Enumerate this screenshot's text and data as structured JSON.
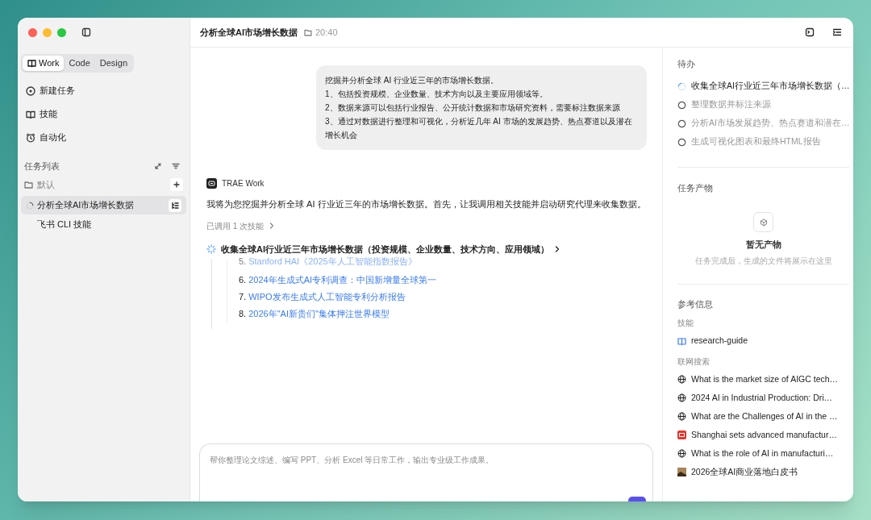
{
  "sidebar": {
    "modes": [
      {
        "label": "Work",
        "selected": true
      },
      {
        "label": "Code",
        "selected": false
      },
      {
        "label": "Design",
        "selected": false
      }
    ],
    "nav": [
      {
        "label": "新建任务",
        "kind": "chat"
      },
      {
        "label": "技能",
        "kind": "book"
      },
      {
        "label": "自动化",
        "kind": "alarm"
      }
    ],
    "task_list_title": "任务列表",
    "group": "默认",
    "tasks": [
      {
        "title": "分析全球AI市场增长数据",
        "selected": true,
        "running": true
      },
      {
        "title": "飞书 CLI 技能",
        "selected": false,
        "running": false
      }
    ]
  },
  "header": {
    "title": "分析全球AI市场增长数据",
    "time": "20:40"
  },
  "user_message": [
    "挖掘并分析全球 AI 行业近三年的市场增长数据。",
    "1、包括投资规模、企业数量、技术方向以及主要应用领域等。",
    "2、数据来源可以包括行业报告、公开统计数据和市场研究资料，需要标注数据来源",
    "3、通过对数据进行整理和可视化，分析近几年 AI 市场的发展趋势、热点赛道以及潜在增长机会"
  ],
  "assistant": {
    "name": "TRAE Work",
    "text": "我将为您挖掘并分析全球 AI 行业近三年的市场增长数据。首先，让我调用相关技能并启动研究代理来收集数据。",
    "skill_calls": "已调用 1 次技能",
    "step": {
      "title": "收集全球AI行业近三年市场增长数据（投资规模、企业数量、技术方向、应用领域）",
      "running": true,
      "results": [
        {
          "number": "5.",
          "title": "Stanford HAI《2025年人工智能指数报告》",
          "faded": true
        },
        {
          "number": "6.",
          "title": "2024年生成式AI专利调查：中国新增量全球第一",
          "faded": false
        },
        {
          "number": "7.",
          "title": "WIPO发布生成式人工智能专利分析报告",
          "faded": false
        },
        {
          "number": "8.",
          "title": "2026年\"AI新贵们\"集体押注世界模型",
          "faded": false
        }
      ]
    }
  },
  "composer": {
    "placeholder": "帮你整理论文综述、编写 PPT、分析 Excel 等日常工作，输出专业级工作成果。"
  },
  "todo": {
    "title": "待办",
    "items": [
      {
        "text": "收集全球AI行业近三年市场增长数据（…",
        "running": true
      },
      {
        "text": "整理数据并标注来源",
        "running": false
      },
      {
        "text": "分析AI市场发展趋势、热点赛道和潜在…",
        "running": false
      },
      {
        "text": "生成可视化图表和最终HTML报告",
        "running": false
      }
    ]
  },
  "outputs": {
    "title": "任务产物",
    "empty_title": "暂无产物",
    "empty_text": "任务完成后，生成的文件将展示在这里"
  },
  "references": {
    "title": "参考信息",
    "skills_label": "技能",
    "skills": [
      "research-guide"
    ],
    "search_label": "联网搜索",
    "results": [
      {
        "text": "What is the market size of AIGC tech…",
        "kind": "web"
      },
      {
        "text": "2024 AI in Industrial Production: Dri…",
        "kind": "web"
      },
      {
        "text": "What are the Challenges of AI in the …",
        "kind": "web"
      },
      {
        "text": "Shanghai sets advanced manufactur…",
        "kind": "news"
      },
      {
        "text": "What is the role of AI in manufacturi…",
        "kind": "web"
      },
      {
        "text": "2026全球AI商业落地白皮书",
        "kind": "doc"
      }
    ]
  }
}
